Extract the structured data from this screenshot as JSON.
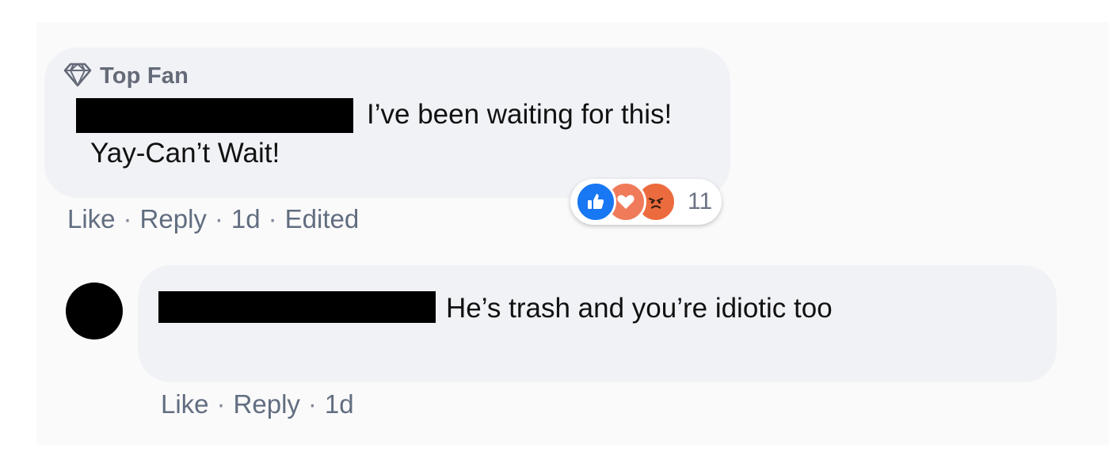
{
  "comment1": {
    "badge": "Top Fan",
    "text_line1": "I’ve been waiting for this!",
    "text_line2": "Yay-Can’t Wait!",
    "actions": {
      "like": "Like",
      "reply": "Reply",
      "time": "1d",
      "edited": "Edited"
    },
    "reactions": {
      "icons": [
        "like-icon",
        "love-icon",
        "angry-icon"
      ],
      "count": "11"
    }
  },
  "comment2": {
    "text": "He’s trash and you’re idiotic too",
    "actions": {
      "like": "Like",
      "reply": "Reply",
      "time": "1d"
    }
  },
  "separator": "·",
  "colors": {
    "bubble": "#f1f2f6",
    "action_text": "#616d80",
    "like": "#1877f2",
    "love": "#f07b5a",
    "angry": "#ec6b3e"
  }
}
